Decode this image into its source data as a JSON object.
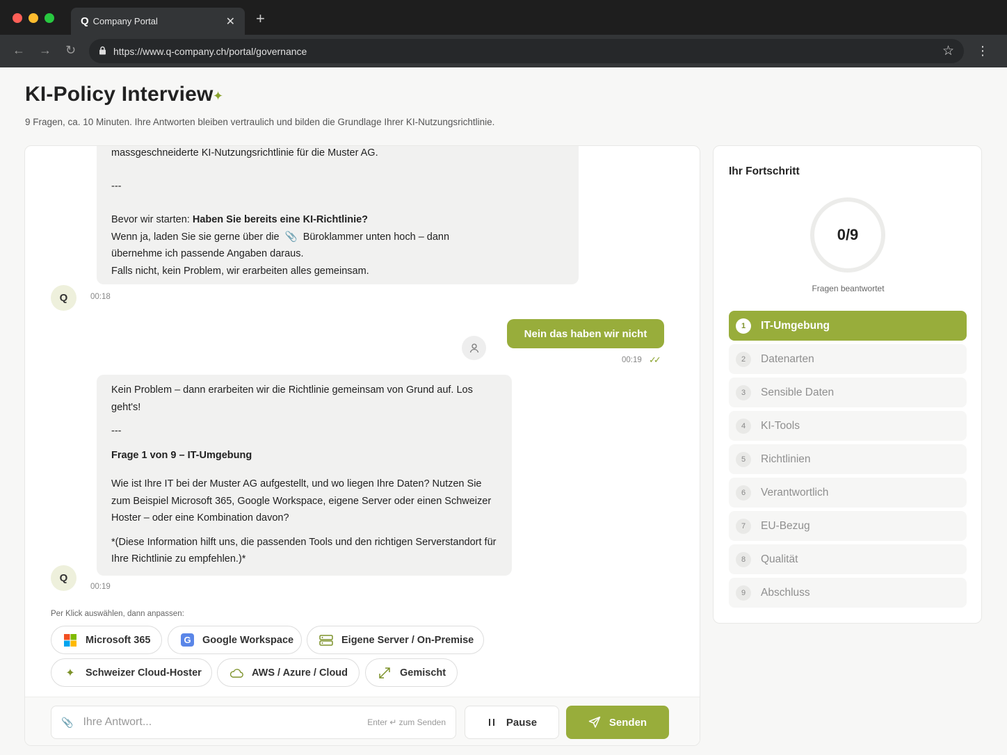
{
  "browser": {
    "tab_title": "Company Portal",
    "tab_icon": "Q",
    "url": "https://www.q-company.ch/portal/governance"
  },
  "page": {
    "title": "KI-Policy Interview",
    "subtitle": "9 Fragen, ca. 10 Minuten. Ihre Antworten bleiben vertraulich und bilden die Grundlage Ihrer KI-Nutzungsrichtlinie."
  },
  "chat": {
    "msg1": {
      "line_top": "massgeschneiderte KI-Nutzungsrichtlinie für die Muster AG.",
      "separator": "---",
      "q_prefix": "Bevor wir starten: ",
      "q_bold": "Haben Sie bereits eine KI-Richtlinie?",
      "line_a": "Wenn ja, laden Sie sie gerne über die",
      "line_a2": "Büroklammer unten hoch – dann",
      "line_b": "übernehme ich passende Angaben daraus.",
      "line_c": "Falls nicht, kein Problem, wir erarbeiten alles gemeinsam.",
      "avatar": "Q",
      "time": "00:18"
    },
    "user_msg": {
      "text": "Nein das haben wir nicht",
      "time": "00:19"
    },
    "msg2": {
      "intro": "Kein Problem – dann erarbeiten wir die Richtlinie gemeinsam von Grund auf. Los geht's!",
      "separator": "---",
      "heading": "Frage 1 von 9 – IT-Umgebung",
      "question": "Wie ist Ihre IT bei der Muster AG aufgestellt, und wo liegen Ihre Daten? Nutzen Sie zum Beispiel Microsoft 365, Google Workspace, eigene Server oder einen Schweizer Hoster – oder eine Kombination davon?",
      "note": "*(Diese Information hilft uns, die passenden Tools und den richtigen Serverstandort für Ihre Richtlinie zu empfehlen.)*",
      "avatar": "Q",
      "time": "00:19"
    },
    "hint": "Per Klick auswählen, dann anpassen:",
    "chips": [
      {
        "label": "Microsoft 365",
        "icon": "microsoft-logo-icon"
      },
      {
        "label": "Google Workspace",
        "icon": "google-logo-icon"
      },
      {
        "label": "Eigene Server / On-Premise",
        "icon": "server-icon"
      },
      {
        "label": "Schweizer Cloud-Hoster",
        "icon": "sparkle-icon"
      },
      {
        "label": "AWS / Azure / Cloud",
        "icon": "cloud-icon"
      },
      {
        "label": "Gemischt",
        "icon": "expand-arrows-icon"
      }
    ],
    "composer": {
      "placeholder": "Ihre Antwort...",
      "enter_hint": "Enter ↵ zum Senden",
      "pause_label": "Pause",
      "send_label": "Senden"
    }
  },
  "progress": {
    "title": "Ihr Fortschritt",
    "value": "0/9",
    "answered": 0,
    "total": 9,
    "label": "Fragen beantwortet",
    "active_step": 1,
    "steps": [
      {
        "num": "1",
        "label": "IT-Umgebung"
      },
      {
        "num": "2",
        "label": "Datenarten"
      },
      {
        "num": "3",
        "label": "Sensible Daten"
      },
      {
        "num": "4",
        "label": "KI-Tools"
      },
      {
        "num": "5",
        "label": "Richtlinien"
      },
      {
        "num": "6",
        "label": "Verantwortlich"
      },
      {
        "num": "7",
        "label": "EU-Bezug"
      },
      {
        "num": "8",
        "label": "Qualität"
      },
      {
        "num": "9",
        "label": "Abschluss"
      }
    ]
  },
  "colors": {
    "accent": "#98ad3b",
    "accent_dark": "#7d922a",
    "chrome_dark": "#1e1e1e",
    "chrome_mid": "#333537"
  }
}
